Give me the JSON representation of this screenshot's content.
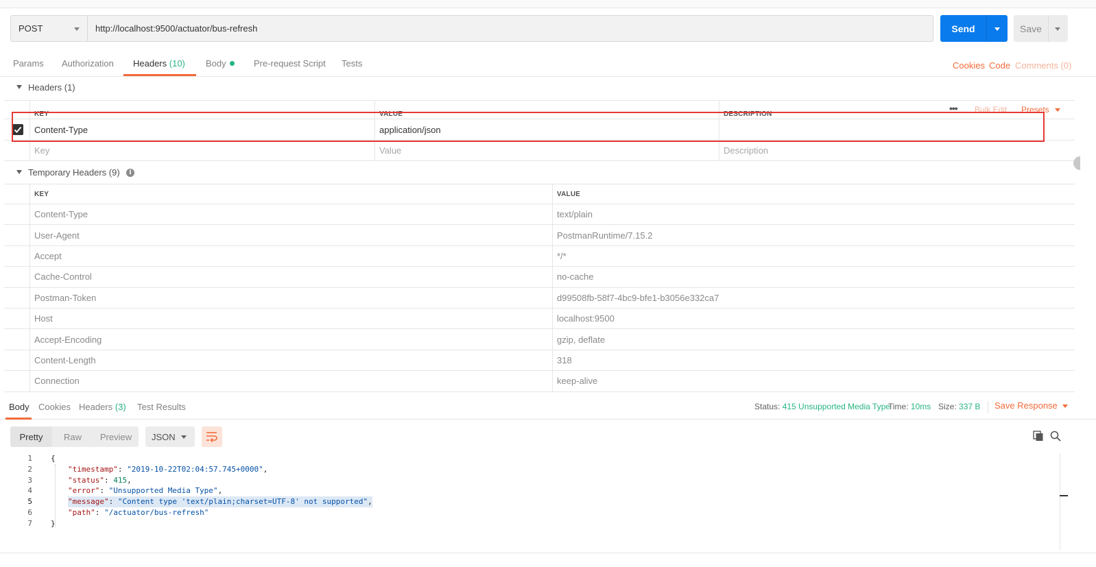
{
  "request": {
    "method": "POST",
    "url": "http://localhost:9500/actuator/bus-refresh",
    "send_label": "Send",
    "save_label": "Save"
  },
  "request_tabs": [
    {
      "label": "Params"
    },
    {
      "label": "Authorization"
    },
    {
      "label": "Headers",
      "count": "(10)"
    },
    {
      "label": "Body"
    },
    {
      "label": "Pre-request Script"
    },
    {
      "label": "Tests"
    }
  ],
  "right_links": {
    "cookies": "Cookies",
    "code": "Code",
    "comments": "Comments (0)"
  },
  "headers_section": {
    "title": "Headers (1)",
    "columns": {
      "key": "KEY",
      "value": "VALUE",
      "description": "DESCRIPTION"
    },
    "bulk_edit": "Bulk Edit",
    "presets": "Presets",
    "rows": [
      {
        "key": "Content-Type",
        "value": "application/json",
        "description": ""
      }
    ],
    "placeholders": {
      "key": "Key",
      "value": "Value",
      "description": "Description"
    }
  },
  "temp_headers": {
    "title": "Temporary Headers (9)",
    "columns": {
      "key": "KEY",
      "value": "VALUE"
    },
    "rows": [
      {
        "key": "Content-Type",
        "value": "text/plain"
      },
      {
        "key": "User-Agent",
        "value": "PostmanRuntime/7.15.2"
      },
      {
        "key": "Accept",
        "value": "*/*"
      },
      {
        "key": "Cache-Control",
        "value": "no-cache"
      },
      {
        "key": "Postman-Token",
        "value": "d99508fb-58f7-4bc9-bfe1-b3056e332ca7"
      },
      {
        "key": "Host",
        "value": "localhost:9500"
      },
      {
        "key": "Accept-Encoding",
        "value": "gzip, deflate"
      },
      {
        "key": "Content-Length",
        "value": "318"
      },
      {
        "key": "Connection",
        "value": "keep-alive"
      }
    ]
  },
  "response": {
    "tabs": [
      {
        "label": "Body"
      },
      {
        "label": "Cookies"
      },
      {
        "label": "Headers",
        "count": "(3)"
      },
      {
        "label": "Test Results"
      }
    ],
    "status_label": "Status:",
    "status_value": "415 Unsupported Media Type",
    "time_label": "Time:",
    "time_value": "10ms",
    "size_label": "Size:",
    "size_value": "337 B",
    "save_response": "Save Response",
    "views": [
      "Pretty",
      "Raw",
      "Preview"
    ],
    "format": "JSON",
    "lines": [
      {
        "n": "1",
        "parts": [
          [
            "p",
            "{"
          ]
        ]
      },
      {
        "n": "2",
        "parts": [
          [
            "k",
            "\"timestamp\""
          ],
          [
            "p",
            ": "
          ],
          [
            "s",
            "\"2019-10-22T02:04:57.745+0000\""
          ],
          [
            "p",
            ","
          ]
        ]
      },
      {
        "n": "3",
        "parts": [
          [
            "k",
            "\"status\""
          ],
          [
            "p",
            ": "
          ],
          [
            "n",
            "415"
          ],
          [
            "p",
            ","
          ]
        ]
      },
      {
        "n": "4",
        "parts": [
          [
            "k",
            "\"error\""
          ],
          [
            "p",
            ": "
          ],
          [
            "s",
            "\"Unsupported Media Type\""
          ],
          [
            "p",
            ","
          ]
        ]
      },
      {
        "n": "5",
        "parts": [
          [
            "k",
            "\"message\""
          ],
          [
            "p",
            ": "
          ],
          [
            "s",
            "\"Content type 'text/plain;charset=UTF-8' not supported\""
          ],
          [
            "p",
            ","
          ]
        ]
      },
      {
        "n": "6",
        "parts": [
          [
            "k",
            "\"path\""
          ],
          [
            "p",
            ": "
          ],
          [
            "s",
            "\"/actuator/bus-refresh\""
          ]
        ]
      },
      {
        "n": "7",
        "parts": [
          [
            "p",
            "}"
          ]
        ]
      }
    ]
  },
  "colors": {
    "accent": "#f26b3a",
    "send": "#097bed",
    "success": "#26b47f"
  }
}
